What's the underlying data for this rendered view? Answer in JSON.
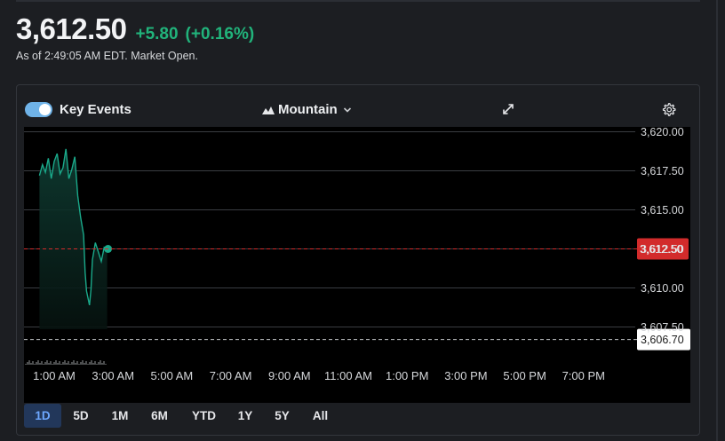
{
  "quote": {
    "price": "3,612.50",
    "change": "+5.80",
    "change_pct": "(+0.16%)",
    "as_of": "As of 2:49:05 AM EDT. Market Open.",
    "change_color": "#21b37b"
  },
  "toolbar": {
    "key_events_label": "Key Events",
    "key_events_on": true,
    "chart_type_label": "Mountain",
    "icons": [
      "mountain-icon",
      "chevron-down-icon",
      "expand-icon",
      "gear-icon"
    ]
  },
  "chart_data": {
    "type": "area",
    "title": "",
    "xlabel": "",
    "ylabel": "",
    "x_tick_labels": [
      "1:00 AM",
      "3:00 AM",
      "5:00 AM",
      "7:00 AM",
      "9:00 AM",
      "11:00 AM",
      "1:00 PM",
      "3:00 PM",
      "5:00 PM",
      "7:00 PM"
    ],
    "y_tick_labels": [
      "3,620.00",
      "3,617.50",
      "3,615.00",
      "3,612.50",
      "3,610.00",
      "3,607.50"
    ],
    "y_ticks": [
      3620.0,
      3617.5,
      3615.0,
      3612.5,
      3610.0,
      3607.5
    ],
    "ylim": [
      3605.0,
      3620.5
    ],
    "x_start_hour": 0.5,
    "x_end_hour": 20.0,
    "current_price": 3612.5,
    "current_price_label": "3,612.50",
    "reference_price": 3606.7,
    "reference_price_label": "3,606.70",
    "line_color": "#1aa98a",
    "current_price_color": "#d22b2b",
    "grid": true,
    "series": [
      {
        "x": [
          0.5,
          0.6,
          0.7,
          0.8,
          0.9,
          1.0,
          1.1,
          1.2,
          1.3,
          1.4,
          1.5,
          1.6,
          1.7,
          1.75,
          1.8,
          1.9,
          2.0,
          2.05,
          2.1,
          2.2,
          2.25,
          2.3,
          2.4,
          2.5,
          2.6,
          2.7,
          2.8
        ],
        "values": [
          3617.2,
          3617.9,
          3617.4,
          3618.3,
          3617.0,
          3618.1,
          3618.6,
          3617.3,
          3617.7,
          3618.9,
          3617.0,
          3617.6,
          3618.4,
          3617.2,
          3615.9,
          3614.5,
          3613.4,
          3611.0,
          3609.8,
          3608.9,
          3609.9,
          3611.8,
          3612.9,
          3612.3,
          3611.7,
          3612.6,
          3612.5
        ]
      }
    ]
  },
  "ranges": {
    "items": [
      "1D",
      "5D",
      "1M",
      "6M",
      "YTD",
      "1Y",
      "5Y",
      "All"
    ],
    "active_index": 0
  }
}
